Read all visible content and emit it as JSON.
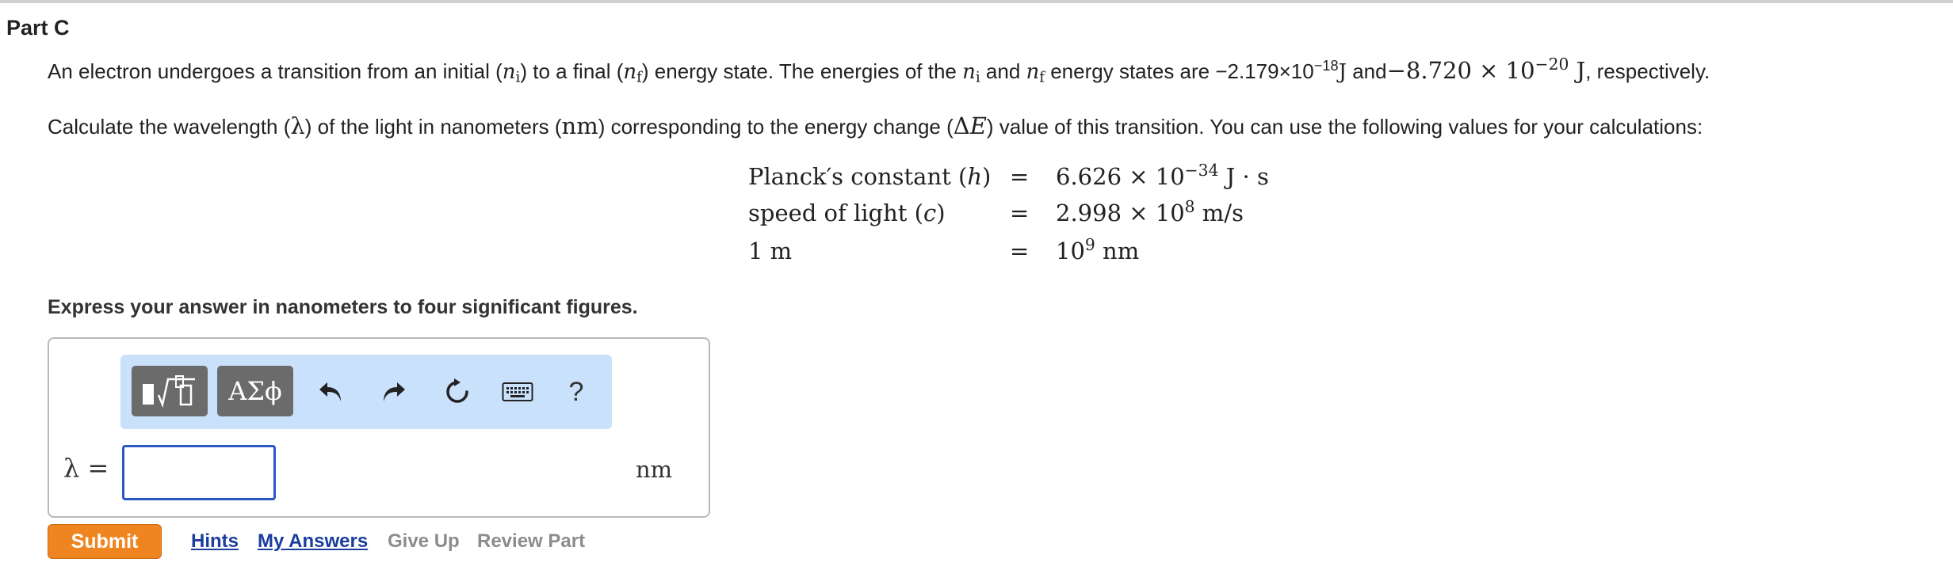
{
  "part": {
    "title": "Part C"
  },
  "problem": {
    "p1": {
      "t1": "An electron undergoes a transition from an initial (",
      "ni_base": "n",
      "ni_sub": "i",
      "t2": ") to a final (",
      "nf_base": "n",
      "nf_sub": "f",
      "t3": ") energy state. The energies of the ",
      "t4": " and ",
      "t5": " energy states are ",
      "e1_mant": "−2.179×10",
      "e1_exp": "−18",
      "e1_unit": "J",
      "t6": " and",
      "e2_mant": "−8.720 × 10",
      "e2_exp": "−20",
      "e2_unit": " J",
      "t7": ", respectively."
    },
    "p2": {
      "t1": "Calculate the wavelength (",
      "lambda": "λ",
      "t2": ") of the light in nanometers (",
      "nm": "nm",
      "t3": ") corresponding to the energy change (",
      "delta": "Δ",
      "e": "E",
      "t4": ") value of this transition. You can use the following values for your calculations:"
    },
    "constants": [
      {
        "label_pre": "Planck′s constant (",
        "label_sym": "h",
        "label_post": ")",
        "eq": "=",
        "val_pre": "6.626 × 10",
        "val_exp": "−34",
        "val_post": " J · s"
      },
      {
        "label_pre": "speed of light (",
        "label_sym": "c",
        "label_post": ")",
        "eq": "=",
        "val_pre": "2.998 × 10",
        "val_exp": "8",
        "val_post": " m/s"
      },
      {
        "label_pre": "1 m",
        "label_sym": "",
        "label_post": "",
        "eq": "=",
        "val_pre": "10",
        "val_exp": "9",
        "val_post": " nm"
      }
    ]
  },
  "instruction": "Express your answer in nanometers to four significant figures.",
  "toolbar": {
    "templates_icon": "templates-icon",
    "symbols_label": "ΑΣϕ",
    "undo_icon": "undo-icon",
    "redo_icon": "redo-icon",
    "reset_icon": "reset-icon",
    "keyboard_icon": "keyboard-icon",
    "help_label": "?"
  },
  "answer": {
    "label": "λ =",
    "value": "",
    "unit": "nm"
  },
  "actions": {
    "submit": "Submit",
    "hints": "Hints",
    "my_answers": "My Answers",
    "give_up": "Give Up",
    "review_part": "Review Part"
  },
  "colors": {
    "submit": "#ef8520",
    "toolbar_bg": "#c9e1fb",
    "link": "#1a3d9e",
    "disabled_link": "#8c8c8c",
    "input_border": "#2a57c6"
  }
}
